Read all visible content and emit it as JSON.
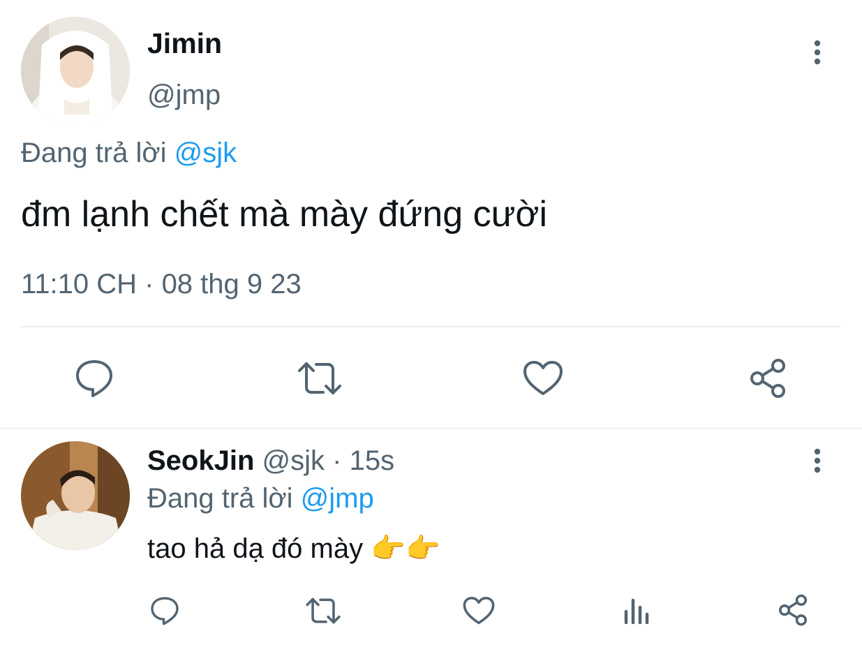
{
  "main_tweet": {
    "display_name": "Jimin",
    "handle": "@jmp",
    "replying_prefix": "Đang trả lời",
    "replying_to": "@sjk",
    "text": "đm lạnh chết mà mày đứng cười",
    "timestamp": "11:10 CH · 08 thg 9 23",
    "actions": [
      "reply-icon",
      "retweet-icon",
      "like-icon",
      "share-icon"
    ]
  },
  "reply_tweet": {
    "display_name": "SeokJin",
    "handle": "@sjk",
    "separator": "·",
    "age": "15s",
    "replying_prefix": "Đang trả lời",
    "replying_to": "@jmp",
    "text": "tao hả dạ đó mày",
    "emoji": "👉👉",
    "actions": [
      "reply-icon",
      "retweet-icon",
      "like-icon",
      "views-icon",
      "share-icon"
    ]
  },
  "colors": {
    "text": "#0f1419",
    "muted": "#536471",
    "link": "#1d9bf0",
    "divider": "#eff3f4"
  }
}
